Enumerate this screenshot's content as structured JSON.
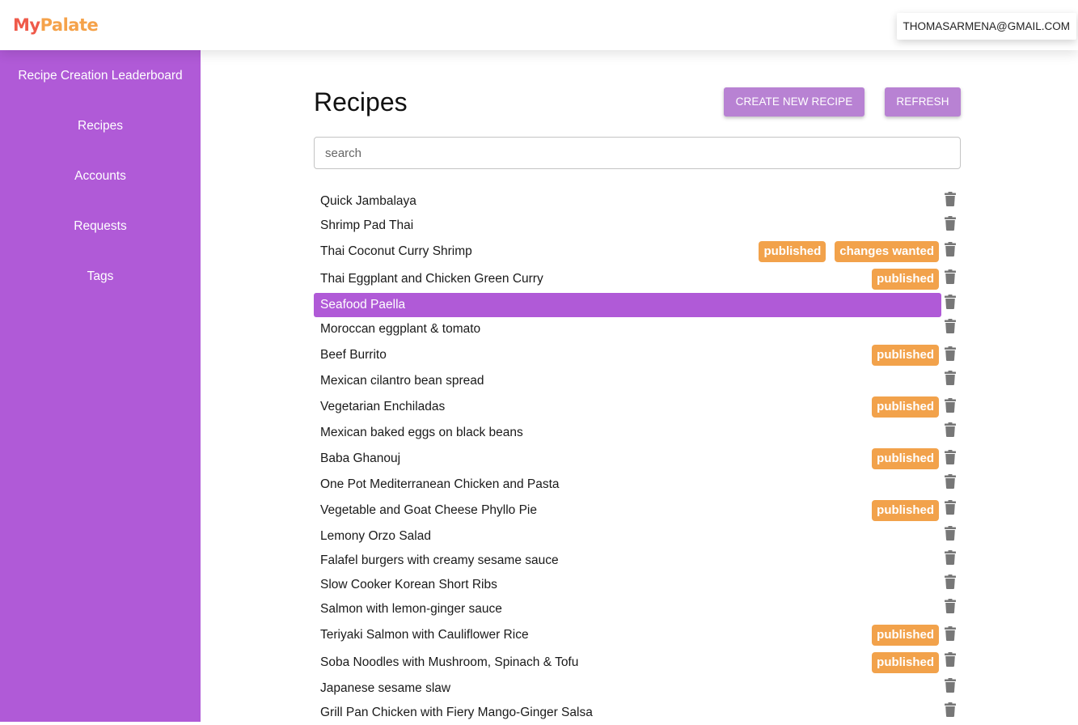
{
  "header": {
    "logo_part1": "My",
    "logo_part2": "Palate",
    "account_email": "THOMASARMENA@GMAIL.COM"
  },
  "sidebar": {
    "items": [
      {
        "label": "Recipe Creation Leaderboard"
      },
      {
        "label": "Recipes"
      },
      {
        "label": "Accounts"
      },
      {
        "label": "Requests"
      },
      {
        "label": "Tags"
      }
    ]
  },
  "main": {
    "title": "Recipes",
    "create_button": "CREATE NEW RECIPE",
    "refresh_button": "REFRESH",
    "search_placeholder": "search",
    "recipes": [
      {
        "name": "Quick Jambalaya",
        "badges": [],
        "selected": false
      },
      {
        "name": "Shrimp Pad Thai",
        "badges": [],
        "selected": false
      },
      {
        "name": "Thai Coconut Curry Shrimp",
        "badges": [
          "published",
          "changes wanted"
        ],
        "selected": false
      },
      {
        "name": "Thai Eggplant and Chicken Green Curry",
        "badges": [
          "published"
        ],
        "selected": false
      },
      {
        "name": "Seafood Paella",
        "badges": [],
        "selected": true
      },
      {
        "name": "Moroccan eggplant & tomato",
        "badges": [],
        "selected": false
      },
      {
        "name": "Beef Burrito",
        "badges": [
          "published"
        ],
        "selected": false
      },
      {
        "name": "Mexican cilantro bean spread",
        "badges": [],
        "selected": false
      },
      {
        "name": "Vegetarian Enchiladas",
        "badges": [
          "published"
        ],
        "selected": false
      },
      {
        "name": "Mexican baked eggs on black beans",
        "badges": [],
        "selected": false
      },
      {
        "name": "Baba Ghanouj",
        "badges": [
          "published"
        ],
        "selected": false
      },
      {
        "name": "One Pot Mediterranean Chicken and Pasta",
        "badges": [],
        "selected": false
      },
      {
        "name": "Vegetable and Goat Cheese Phyllo Pie",
        "badges": [
          "published"
        ],
        "selected": false
      },
      {
        "name": "Lemony Orzo Salad",
        "badges": [],
        "selected": false
      },
      {
        "name": "Falafel burgers with creamy sesame sauce",
        "badges": [],
        "selected": false
      },
      {
        "name": "Slow Cooker Korean Short Ribs",
        "badges": [],
        "selected": false
      },
      {
        "name": "Salmon with lemon-ginger sauce",
        "badges": [],
        "selected": false
      },
      {
        "name": "Teriyaki Salmon with Cauliflower Rice",
        "badges": [
          "published"
        ],
        "selected": false
      },
      {
        "name": "Soba Noodles with Mushroom, Spinach & Tofu",
        "badges": [
          "published"
        ],
        "selected": false
      },
      {
        "name": "Japanese sesame slaw",
        "badges": [],
        "selected": false
      },
      {
        "name": "Grill Pan Chicken with Fiery Mango-Ginger Salsa",
        "badges": [],
        "selected": false
      }
    ],
    "row_icon": "trash-icon"
  },
  "colors": {
    "sidebar": "#b05ad7",
    "selected_row": "#b05ad7",
    "button": "#b882d3",
    "badge": "#f2a24b",
    "logo_my": "#ef5a4a",
    "logo_palate": "#f5a24a",
    "trash_icon": "#777777"
  }
}
